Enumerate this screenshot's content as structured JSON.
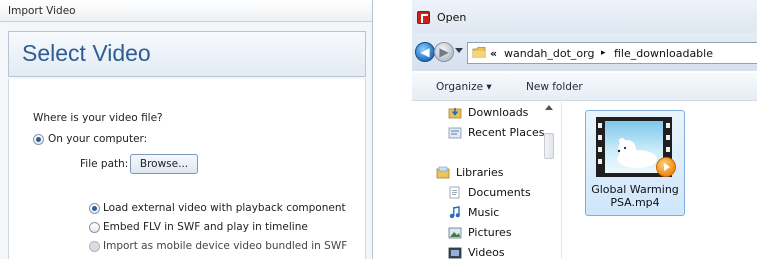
{
  "import_dialog": {
    "title": "Import Video",
    "header": "Select Video",
    "question": "Where is your video file?",
    "on_computer_label": "On your computer:",
    "file_path_label": "File path:",
    "browse_label": "Browse...",
    "options": [
      {
        "label": "Load external video with playback component",
        "selected": true,
        "enabled": true
      },
      {
        "label": "Embed FLV in SWF and play in timeline",
        "selected": false,
        "enabled": true
      },
      {
        "label": "Import as mobile device video bundled in SWF",
        "selected": false,
        "enabled": false
      }
    ]
  },
  "open_dialog": {
    "title": "Open",
    "breadcrumb": [
      "wandah_dot_org",
      "file_downloadable"
    ],
    "breadcrumb_prefix": "«",
    "breadcrumb_separator": "▸",
    "toolbar": {
      "organize": "Organize ▾",
      "new_folder": "New folder"
    },
    "nav_items": [
      {
        "label": "Downloads",
        "icon": "downloads-folder-icon"
      },
      {
        "label": "Recent Places",
        "icon": "recent-places-icon"
      },
      {
        "label": "Libraries",
        "icon": "libraries-icon"
      },
      {
        "label": "Documents",
        "icon": "documents-icon"
      },
      {
        "label": "Music",
        "icon": "music-icon"
      },
      {
        "label": "Pictures",
        "icon": "pictures-icon"
      },
      {
        "label": "Videos",
        "icon": "videos-icon"
      }
    ],
    "file": {
      "name_line1": "Global Warming",
      "name_line2": "PSA.mp4",
      "selected": true
    }
  }
}
